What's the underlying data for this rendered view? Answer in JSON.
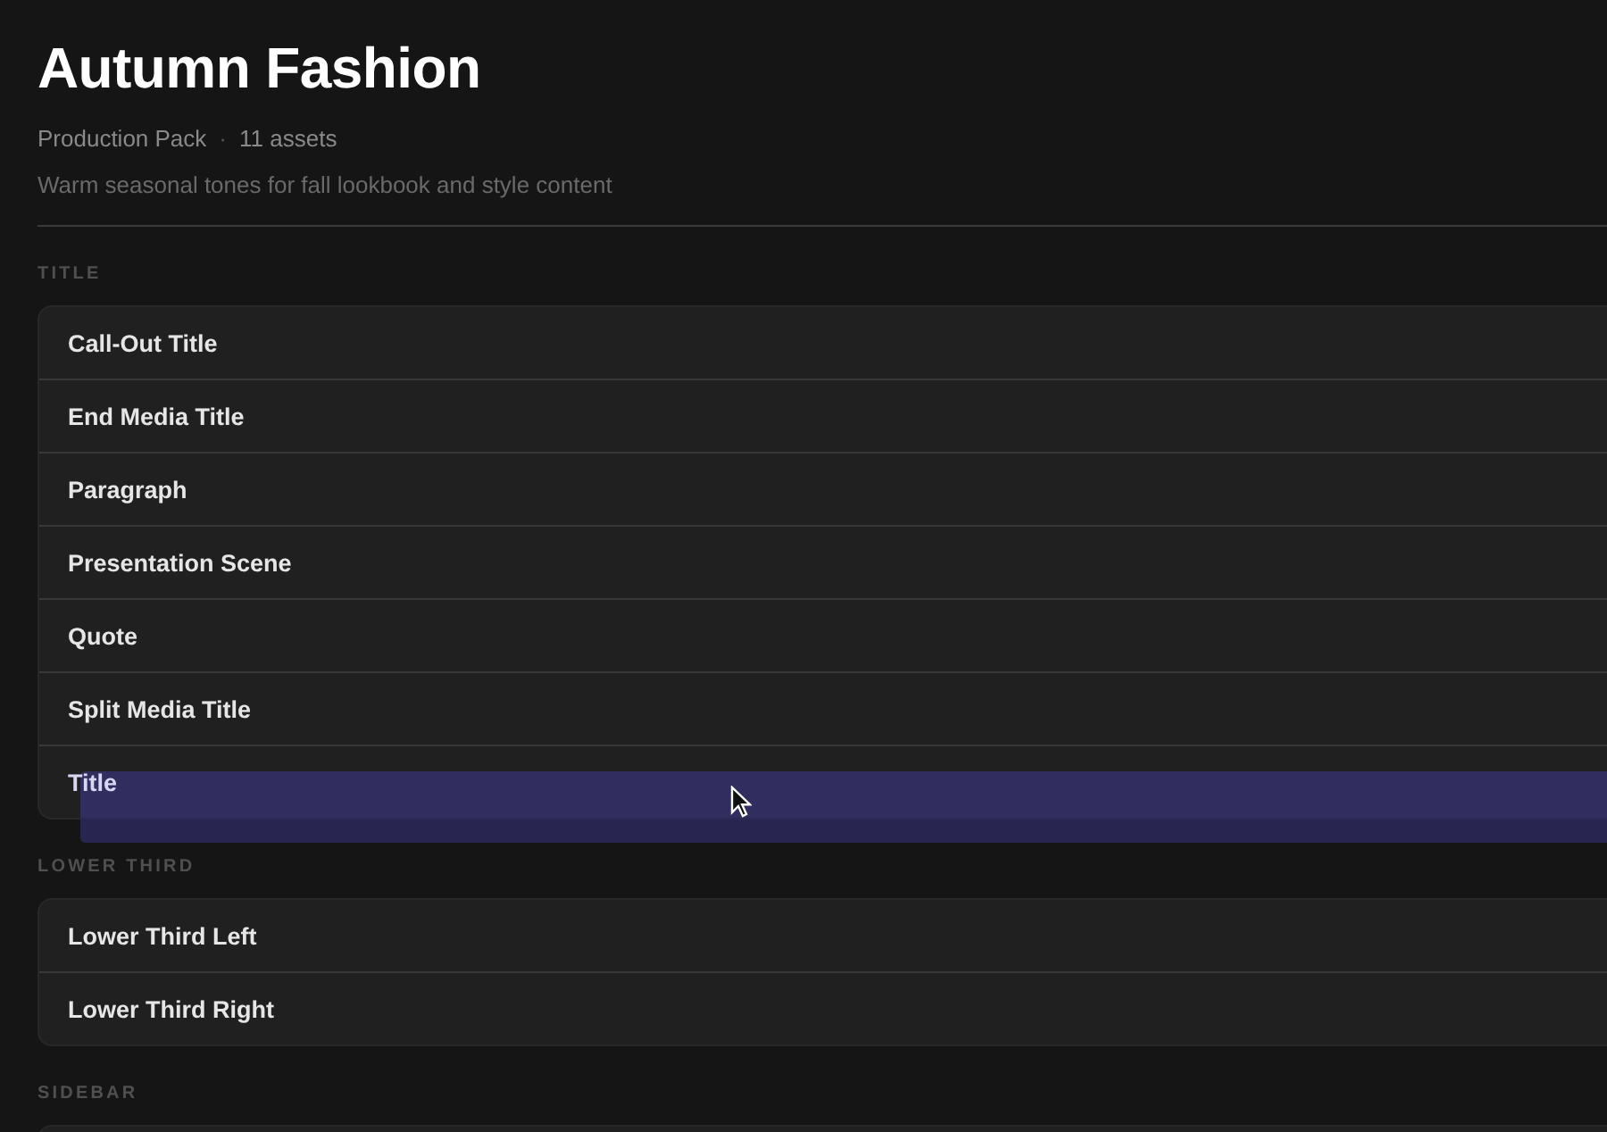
{
  "header": {
    "title": "Autumn Fashion",
    "pack": "Production Pack",
    "separator": "·",
    "count": "11 assets",
    "description": "Warm seasonal tones for fall lookbook and style content"
  },
  "sections": [
    {
      "label": "TITLE",
      "items": [
        {
          "name": "Call-Out Title",
          "dragging": false
        },
        {
          "name": "End Media Title",
          "dragging": false
        },
        {
          "name": "Paragraph",
          "dragging": false
        },
        {
          "name": "Presentation Scene",
          "dragging": false
        },
        {
          "name": "Quote",
          "dragging": false
        },
        {
          "name": "Split Media Title",
          "dragging": false
        },
        {
          "name": "Title",
          "dragging": true
        }
      ]
    },
    {
      "label": "LOWER THIRD",
      "items": [
        {
          "name": "Lower Third Left",
          "dragging": false
        },
        {
          "name": "Lower Third Right",
          "dragging": false
        }
      ]
    },
    {
      "label": "SIDEBAR"
    }
  ]
}
